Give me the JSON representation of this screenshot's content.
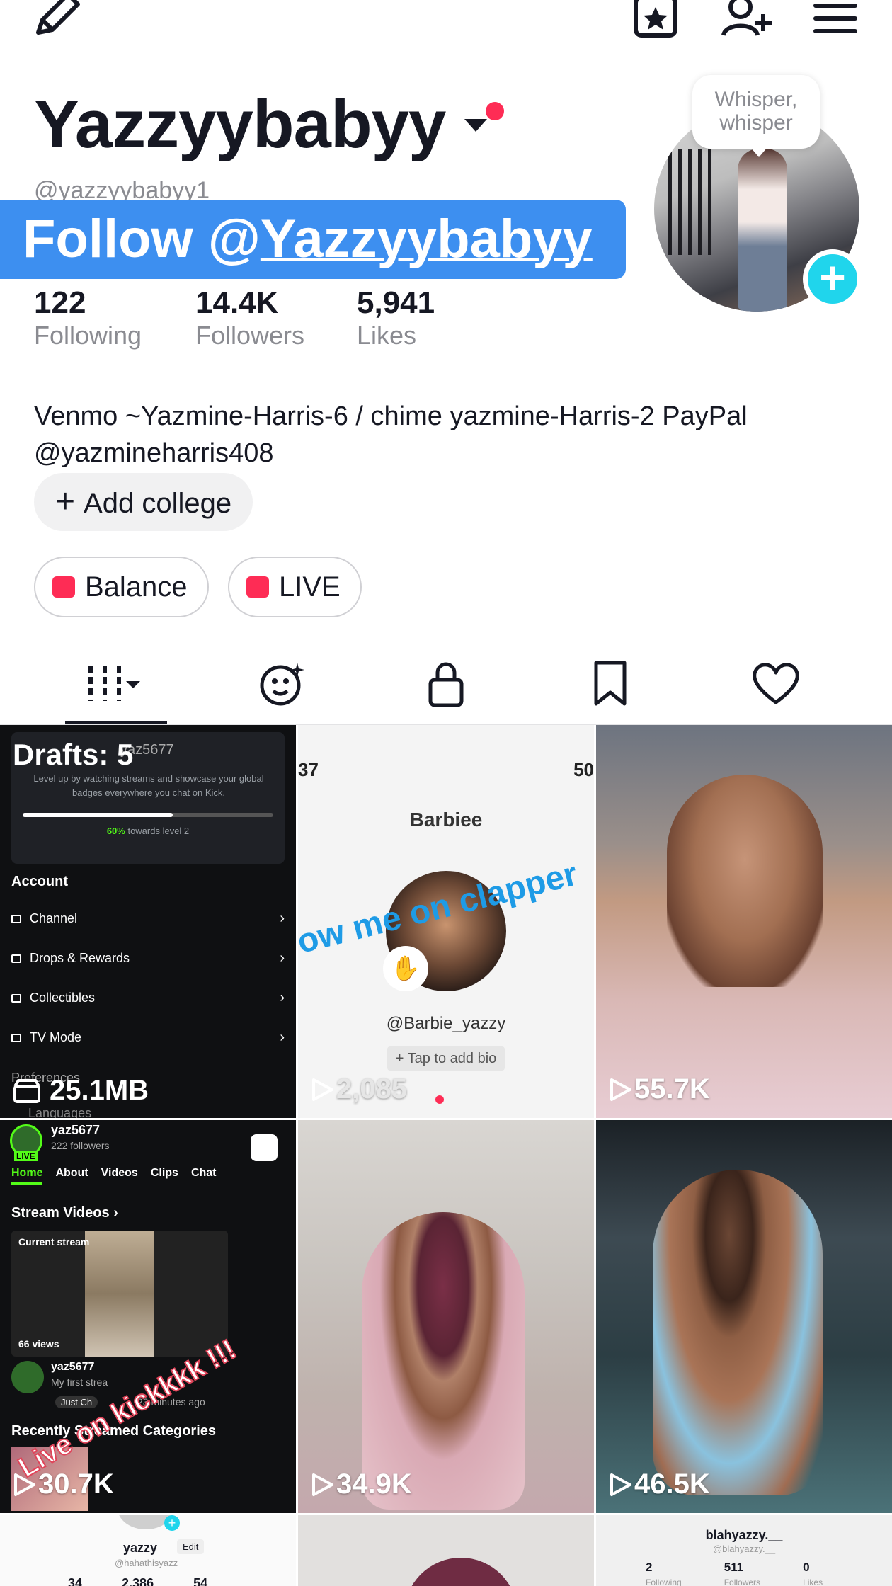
{
  "topbar": {
    "left_icon": "pencil-icon",
    "right_icons": [
      "star-calendar-icon",
      "add-friend-icon",
      "menu-icon"
    ]
  },
  "profile": {
    "display_name": "Yazzyybabyy",
    "username": "@yazzyybabyy1",
    "follow_prefix": "Follow @",
    "follow_name": "Yazzyybabyy",
    "whisper": "Whisper, whisper",
    "stats": [
      {
        "value": "122",
        "label": "Following"
      },
      {
        "value": "14.4K",
        "label": "Followers"
      },
      {
        "value": "5,941",
        "label": "Likes"
      }
    ],
    "bio_line1": "Venmo ~Yazmine-Harris-6 / chime yazmine-Harris-2 PayPal",
    "bio_line2": "@yazmineharris408",
    "add_college": "Add college",
    "balance": "Balance",
    "live": "LIVE"
  },
  "tabs": [
    "grid-icon",
    "smiley-sparkle-icon",
    "lock-icon",
    "bookmark-icon",
    "heart-icon"
  ],
  "colors": {
    "accent": "#fe2c55",
    "follow_banner": "#3d8ff0",
    "add_story": "#20d5ec",
    "kick_green": "#53fc18"
  },
  "grid": {
    "drafts": {
      "label": "Drafts: 5",
      "size": "25.1MB",
      "username": "yaz5677",
      "blurb": "Level up by watching streams and showcase your global badges everywhere you chat on Kick.",
      "progress": 0.6,
      "progress_pct": "60%",
      "progress_text": " towards level 2",
      "section": "Account",
      "menu": [
        "Channel",
        "Drops & Rewards",
        "Collectibles",
        "TV Mode"
      ],
      "pref": "Preferences",
      "lang": "Languages"
    },
    "barbie": {
      "status_left": "37",
      "status_right": "50",
      "name": "Barbiee",
      "overlay": "ow me on clapper",
      "handle": "@Barbie_yazzy",
      "bio_hint": "+ Tap to add bio",
      "views": "2,085"
    },
    "videos": [
      "55.7K",
      "30.7K",
      "34.9K",
      "46.5K"
    ],
    "stream": {
      "username": "yaz5677",
      "followers": "222 followers",
      "live_badge": "LIVE",
      "nav": [
        "Home",
        "About",
        "Videos",
        "Clips",
        "Chat"
      ],
      "section": "Stream Videos",
      "current": "Current stream",
      "views": "66 views",
      "title_user": "yaz5677",
      "title": "My first strea",
      "tag": "Just Ch",
      "ago": "23 minutes ago",
      "categories": "Recently Streamed Categories",
      "overlay": "Live on kickkkk !!!"
    },
    "bottom": {
      "left_name": "yazzy",
      "left_edit": "Edit",
      "left_handle": "@hahathisyazz",
      "left_stats": [
        "34",
        "2,386",
        "54"
      ],
      "right_name": "blahyazzy.__",
      "right_handle": "@blahyazzy.__",
      "right_stats": [
        "2",
        "511",
        "0"
      ],
      "right_labels": [
        "Following",
        "Followers",
        "Likes"
      ]
    }
  }
}
